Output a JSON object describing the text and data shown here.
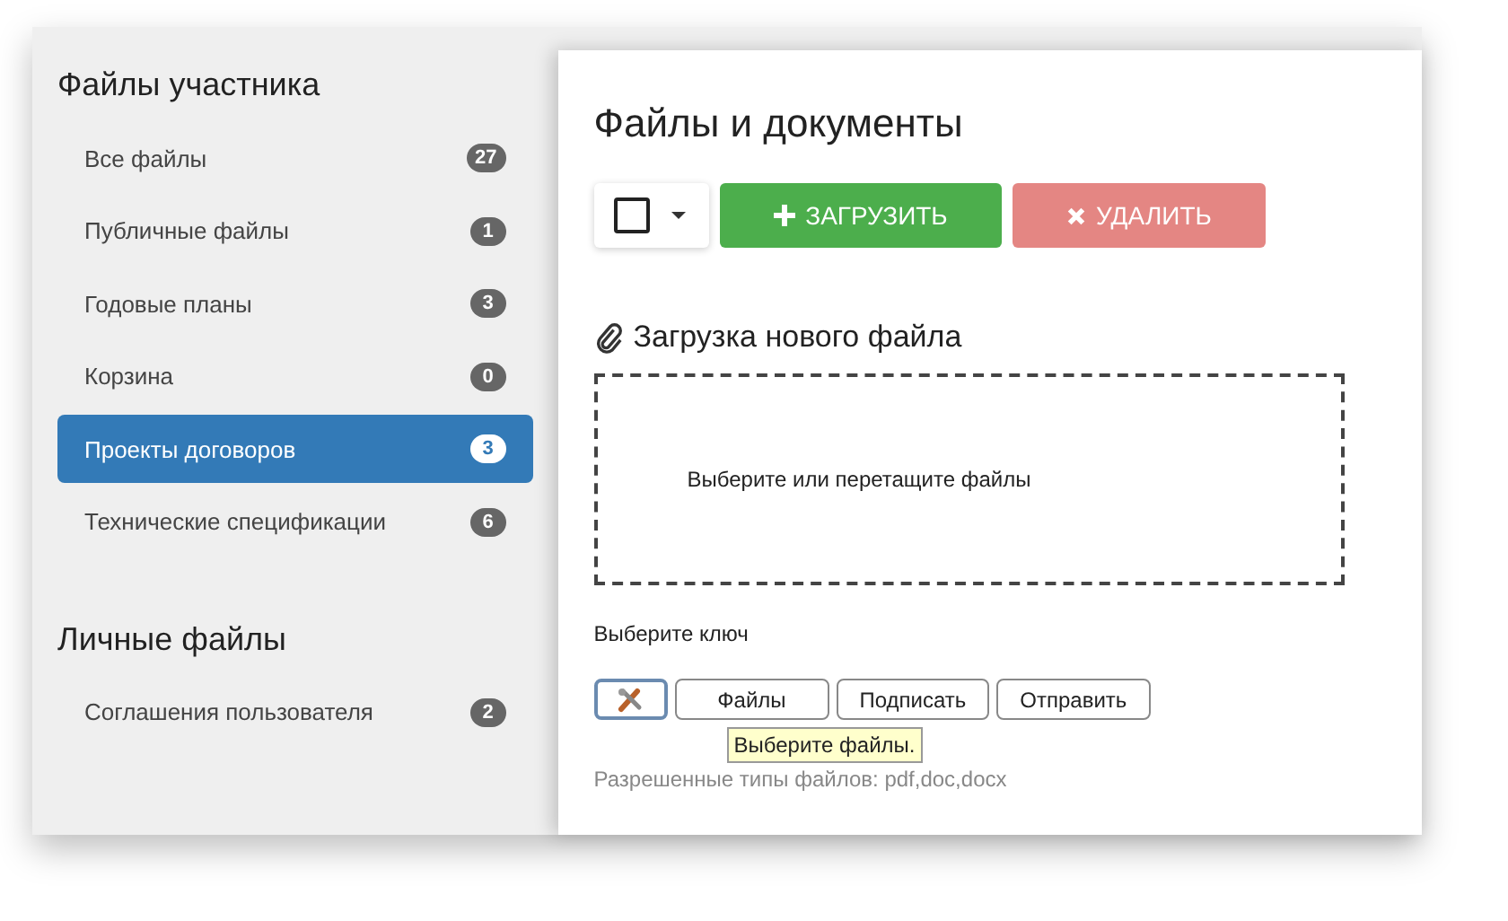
{
  "sidebar": {
    "sections": [
      {
        "title": "Файлы участника",
        "items": [
          {
            "label": "Все файлы",
            "count": "27",
            "selected": false
          },
          {
            "label": "Публичные файлы",
            "count": "1",
            "selected": false
          },
          {
            "label": "Годовые планы",
            "count": "3",
            "selected": false
          },
          {
            "label": "Корзина",
            "count": "0",
            "selected": false
          },
          {
            "label": "Проекты договоров",
            "count": "3",
            "selected": true
          },
          {
            "label": "Технические спецификации",
            "count": "6",
            "selected": false
          }
        ]
      },
      {
        "title": "Личные файлы",
        "items": [
          {
            "label": "Соглашения пользователя",
            "count": "2",
            "selected": false
          }
        ]
      }
    ]
  },
  "main": {
    "title": "Файлы и документы",
    "toolbar": {
      "select_all": {
        "checked": false
      },
      "buttons": [
        {
          "kind": "upload",
          "label": "ЗАГРУЗИТЬ",
          "disabled": false
        },
        {
          "kind": "delete",
          "label": "УДАЛИТЬ",
          "disabled": true
        }
      ]
    },
    "upload": {
      "heading": "Загрузка нового файла",
      "dropzone": "Выберите или перетащите файлы",
      "key_label": "Выберите ключ",
      "key_buttons": [
        {
          "kind": "icon"
        },
        {
          "kind": "text",
          "label": "Файлы"
        },
        {
          "kind": "text",
          "label": "Подписать"
        },
        {
          "kind": "text",
          "label": "Отправить"
        }
      ],
      "tooltip": "Выберите файлы.",
      "allowed_types": "Разрешенные типы файлов: pdf,doc,docx"
    }
  }
}
